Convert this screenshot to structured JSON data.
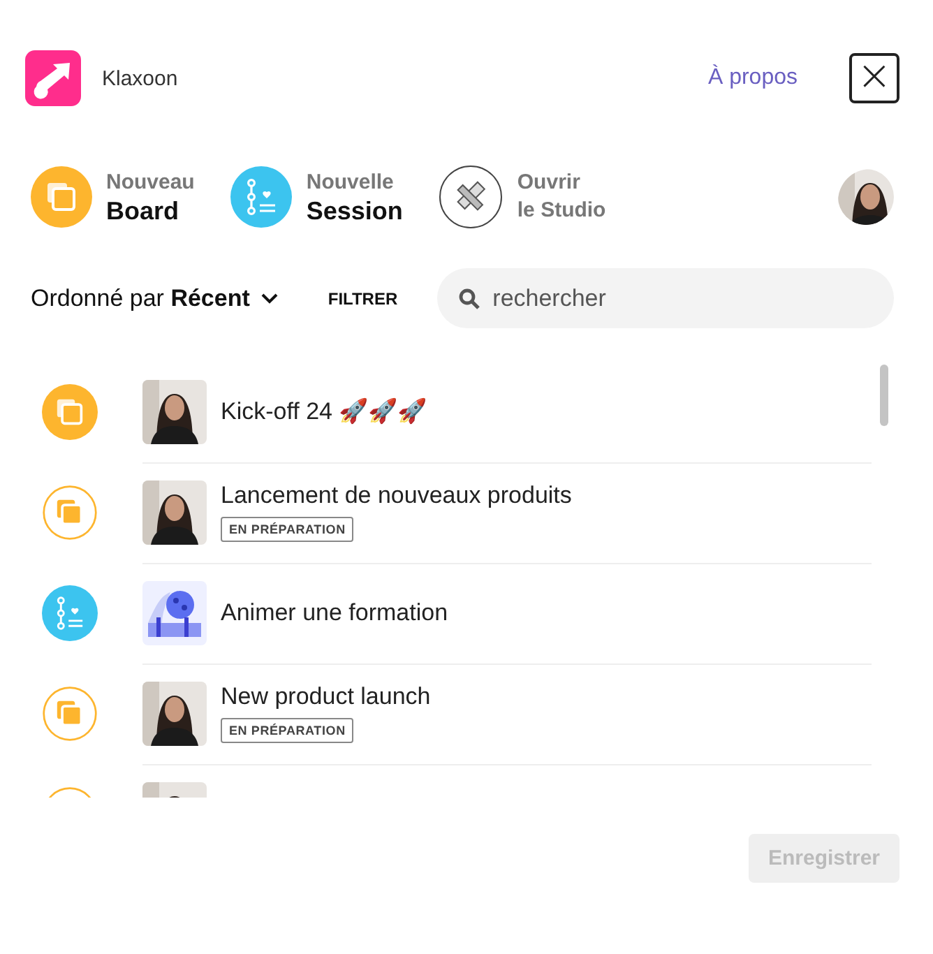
{
  "header": {
    "app_name": "Klaxoon",
    "about_link": "À propos",
    "close_label": "×"
  },
  "actions": [
    {
      "kind": "board",
      "line1": "Nouveau",
      "line2": "Board",
      "strong": true
    },
    {
      "kind": "session",
      "line1": "Nouvelle",
      "line2": "Session",
      "strong": true
    },
    {
      "kind": "studio",
      "line1": "Ouvrir",
      "line2": "le Studio",
      "strong": false
    }
  ],
  "sort": {
    "prefix": "Ordonné par",
    "value": "Récent",
    "filter_label": "FILTRER"
  },
  "search": {
    "placeholder": "rechercher"
  },
  "items": [
    {
      "kind": "board",
      "filled": true,
      "title": "Kick-off 24 🚀🚀🚀"
    },
    {
      "kind": "board",
      "filled": false,
      "title": "Lancement de nouveaux produits",
      "status": "EN PRÉPARATION"
    },
    {
      "kind": "session",
      "title": "Animer une formation"
    },
    {
      "kind": "board",
      "filled": false,
      "title": "New product launch",
      "status": "EN PRÉPARATION"
    },
    {
      "kind": "board",
      "filled": false
    }
  ],
  "footer": {
    "save_label": "Enregistrer",
    "disabled": true
  }
}
